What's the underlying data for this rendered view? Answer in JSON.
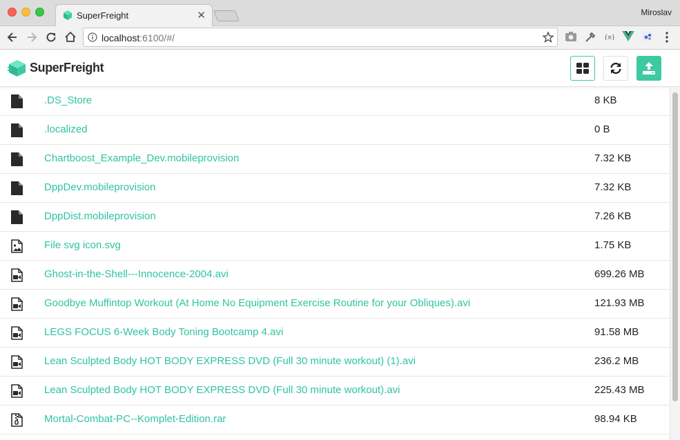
{
  "browser": {
    "tab_title": "SuperFreight",
    "profile_name": "Miroslav",
    "url_host": "localhost",
    "url_rest": ":6100/#/"
  },
  "app": {
    "brand": "SuperFreight",
    "accent_color": "#3ec9a3",
    "toolbar_icons": [
      "grid-view-icon",
      "refresh-icon",
      "upload-icon"
    ]
  },
  "files": [
    {
      "name": ".DS_Store",
      "size": "8 KB",
      "icon": "file-icon"
    },
    {
      "name": ".localized",
      "size": "0 B",
      "icon": "file-icon"
    },
    {
      "name": "Chartboost_Example_Dev.mobileprovision",
      "size": "7.32 KB",
      "icon": "file-icon"
    },
    {
      "name": "DppDev.mobileprovision",
      "size": "7.32 KB",
      "icon": "file-icon"
    },
    {
      "name": "DppDist.mobileprovision",
      "size": "7.26 KB",
      "icon": "file-icon"
    },
    {
      "name": "File svg icon.svg",
      "size": "1.75 KB",
      "icon": "image-file-icon"
    },
    {
      "name": "Ghost-in-the-Shell---Innocence-2004.avi",
      "size": "699.26 MB",
      "icon": "video-file-icon"
    },
    {
      "name": "Goodbye Muffintop Workout (At Home No Equipment Exercise Routine for your Obliques).avi",
      "size": "121.93 MB",
      "icon": "video-file-icon"
    },
    {
      "name": "LEGS FOCUS 6-Week Body Toning Bootcamp 4.avi",
      "size": "91.58 MB",
      "icon": "video-file-icon"
    },
    {
      "name": "Lean Sculpted Body HOT BODY EXPRESS DVD (Full 30 minute workout) (1).avi",
      "size": "236.2 MB",
      "icon": "video-file-icon"
    },
    {
      "name": "Lean Sculpted Body HOT BODY EXPRESS DVD (Full 30 minute workout).avi",
      "size": "225.43 MB",
      "icon": "video-file-icon"
    },
    {
      "name": "Mortal-Combat-PC--Komplet-Edition.rar",
      "size": "98.94 KB",
      "icon": "archive-file-icon"
    }
  ]
}
